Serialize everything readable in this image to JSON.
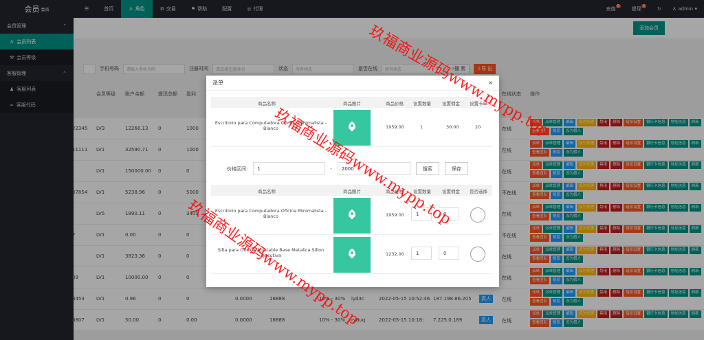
{
  "topbar": {
    "logo": "会员",
    "logo_sup": "会员",
    "nav": [
      "首页",
      "角色",
      "交易",
      "帮助",
      "配置",
      "代理"
    ],
    "recharge": "充值",
    "withdraw": "提现",
    "recharge_badge": "0",
    "withdraw_badge": "0",
    "user": "admin"
  },
  "sidebar": {
    "groups": [
      {
        "label": "会员管理",
        "items": [
          "会员列表",
          "会员等级"
        ]
      },
      {
        "label": "客服管理",
        "items": [
          "客服列表",
          "客服代码"
        ]
      }
    ]
  },
  "main": {
    "add_button": "添加会员",
    "search": {
      "phone_label": "手机号码",
      "phone_placeholder": "请输入手机号码",
      "regtime_label": "注册时间",
      "regtime_placeholder": "请选择注册时间",
      "status_label": "状态",
      "status_value": "所有状态",
      "online_label": "是否在线",
      "online_value": "所有状态",
      "search_btn": "搜 索",
      "export_btn": "导 出"
    },
    "columns": [
      "会员等级",
      "账户余额",
      "提现总额",
      "盈利",
      "在线状态",
      "操作"
    ],
    "rows": [
      {
        "id": "22345",
        "level": "LV3",
        "balance": "12266.13",
        "c1": "0",
        "c2": "1000",
        "status": "在线"
      },
      {
        "id": "11111",
        "level": "LV1",
        "balance": "32590.71",
        "c1": "0",
        "c2": "1000",
        "status": "在线"
      },
      {
        "id": "",
        "level": "LV1",
        "balance": "150000.00",
        "c1": "0",
        "c2": "0",
        "status": "在线"
      },
      {
        "id": "37854",
        "level": "LV1",
        "balance": "5238.96",
        "c1": "0",
        "c2": "5000",
        "status": "不在线"
      },
      {
        "id": "",
        "level": "LV5",
        "balance": "1890.11",
        "c1": "0",
        "c2": "3401",
        "status": "在线"
      },
      {
        "id": "7",
        "level": "LV1",
        "balance": "0.00",
        "c1": "0",
        "c2": "0",
        "status": "不在线"
      },
      {
        "id": "",
        "level": "LV1",
        "balance": "3823.36",
        "c1": "0",
        "c2": "0",
        "status": "在线"
      },
      {
        "id": "09",
        "level": "LV1",
        "balance": "10000.00",
        "c1": "0",
        "c2": "0",
        "status": "在线"
      },
      {
        "id": "8453",
        "level": "LV1",
        "balance": "0.96",
        "c1": "0",
        "c2": "0",
        "status": "在线",
        "x1": "0.0000",
        "x2": "16888",
        "rate": "10% - 30%",
        "code": "iyd3c",
        "time": "2022-05-15 10:52:46",
        "ip": "187.198.86.205",
        "tag": "真人"
      },
      {
        "id": "8807",
        "level": "LV1",
        "balance": "50.00",
        "c1": "0",
        "c2": "0.00",
        "status": "在线",
        "x1": "0.0000",
        "x2": "16888",
        "rate": "10% - 30%",
        "code": "rv8uq",
        "time": "2022-05-15 10:18:",
        "ip": "7.225.0.169",
        "tag": "真人"
      }
    ],
    "ops": [
      "派单",
      "派单管理",
      "编辑",
      "设为代理",
      "禁用",
      "删除",
      "暗扣设置",
      "银行卡信息",
      "地址信息",
      "刷新",
      "查看团队",
      "账变",
      "设为假人"
    ]
  },
  "modal": {
    "title": "派单",
    "close": "×",
    "cols1": [
      "商品名称",
      "商品图片",
      "商品价格",
      "设置数量",
      "设置佣金",
      "设置卡单"
    ],
    "top_item": {
      "name": "Escritorio para Computadora Oficina Minimalista - Blanco",
      "price": "1959.00",
      "qty": "1",
      "commission": "30.00",
      "card": "20"
    },
    "price_label": "价格区间:",
    "price_min": "1",
    "price_sep": "-",
    "price_max": "2000",
    "search": "搜索",
    "save": "保存",
    "cols2": [
      "商品名称",
      "商品图片",
      "商品价格",
      "设置数量",
      "设置佣金",
      "是否选择"
    ],
    "items": [
      {
        "name": "Escritorio para Computadora Oficina Minimalista - Blanco",
        "price": "1959.00",
        "qty": "1",
        "commission": "0"
      },
      {
        "name": "Silla para Oficina Ajustable Base Metalica Sillon ejecutiva",
        "price": "1232.00",
        "qty": "1",
        "commission": "0"
      }
    ]
  },
  "watermark": {
    "a": "玖福商业源码www.mypp.top",
    "b": "玖福商业源码www.mypp.top",
    "c": "玖福商业源码www.mypp.top"
  }
}
